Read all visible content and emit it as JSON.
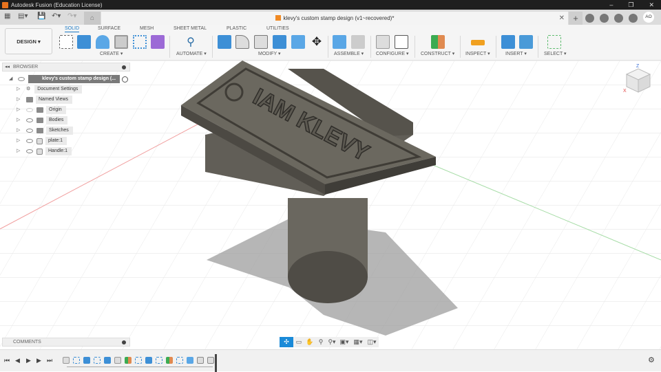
{
  "window": {
    "title": "Autodesk Fusion (Education License)",
    "controls": [
      "–",
      "❐",
      "✕"
    ]
  },
  "document_tab": {
    "title": "klevy's custom stamp design (v1~recovered)*",
    "close": "✕"
  },
  "user": {
    "initials": "AO"
  },
  "workspace": {
    "label": "DESIGN ▾"
  },
  "tabs": [
    "SOLID",
    "SURFACE",
    "MESH",
    "SHEET METAL",
    "PLASTIC",
    "UTILITIES"
  ],
  "groups": [
    "CREATE ▾",
    "AUTOMATE ▾",
    "MODIFY ▾",
    "ASSEMBLE ▾",
    "CONFIGURE ▾",
    "CONSTRUCT ▾",
    "INSPECT ▾",
    "INSERT ▾",
    "SELECT ▾"
  ],
  "browser": {
    "title": "BROWSER",
    "root": "klevy's custom stamp design (...",
    "items": [
      "Document Settings",
      "Named Views",
      "Origin",
      "Bodies",
      "Sketches",
      "plate:1",
      "Handle:1"
    ]
  },
  "comments": {
    "title": "COMMENTS"
  },
  "model": {
    "engraving": "IAM KLEVY"
  },
  "viewcube": {
    "z": "Z",
    "x": "X"
  },
  "colors": {
    "accent": "#1a78c2",
    "model": "#5d5a52"
  }
}
